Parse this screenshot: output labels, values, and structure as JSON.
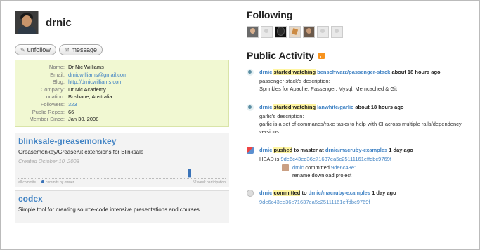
{
  "profile": {
    "username": "drnic",
    "buttons": {
      "unfollow": "unfollow",
      "message": "message"
    },
    "vcard": [
      {
        "key": "Name:",
        "value": "Dr Nic Williams",
        "link": false
      },
      {
        "key": "Email:",
        "value": "drnicwilliams@gmail.com",
        "link": true
      },
      {
        "key": "Blog:",
        "value": "http://drnicwilliams.com",
        "link": true
      },
      {
        "key": "Company:",
        "value": "Dr Nic Academy",
        "link": false
      },
      {
        "key": "Location:",
        "value": "Brisbane, Australia",
        "link": false
      },
      {
        "key": "Followers:",
        "value": "323",
        "link": true
      },
      {
        "key": "Public Repos:",
        "value": "66",
        "link": false
      },
      {
        "key": "Member Since:",
        "value": "Jan 30, 2008",
        "link": false
      }
    ]
  },
  "repos": [
    {
      "name": "blinksale-greasemonkey",
      "description": "Greasemonkey/GreaseKit extensions for Blinksale",
      "created": "Created October 10, 2008",
      "graph": {
        "all": "all commits",
        "owner": "commits by owner",
        "period": "52 week participation"
      }
    },
    {
      "name": "codex",
      "description": "Simple tool for creating source-code intensive presentations and courses"
    }
  ],
  "following": {
    "title": "Following"
  },
  "activity": {
    "title": "Public Activity",
    "items": [
      {
        "user": "drnic",
        "action": "started watching",
        "target": "benschwarz/passenger-stack",
        "time": "about 18 hours ago",
        "detail_label": "passenger-stack's description:",
        "detail": "Sprinkles for Apache, Passenger, Mysql, Memcached & Git"
      },
      {
        "user": "drnic",
        "action": "started watching",
        "target": "lanwhite/garlic",
        "time": "about 18 hours ago",
        "detail_label": "garlic's description:",
        "detail": "garlic is a set of commands/rake tasks to help with CI across multiple rails/dependency versions"
      },
      {
        "user": "drnic",
        "action": "pushed",
        "middle": "to master at",
        "target": "drnic/macruby-examples",
        "time": "1 day ago",
        "head_label": "HEAD is",
        "head": "9de6c43ed36e71637ea5c25111161effdbc9769f",
        "commit_user": "drnic",
        "commit_word": "committed",
        "commit_sha": "9de6c43e:",
        "commit_msg": "rename download project"
      },
      {
        "user": "drnic",
        "action": "committed",
        "middle": "to",
        "target": "drnic/macruby-examples",
        "time": "1 day ago",
        "sha": "9de6c43ed36e71637ea5c25111161effdbc9769f"
      }
    ]
  }
}
